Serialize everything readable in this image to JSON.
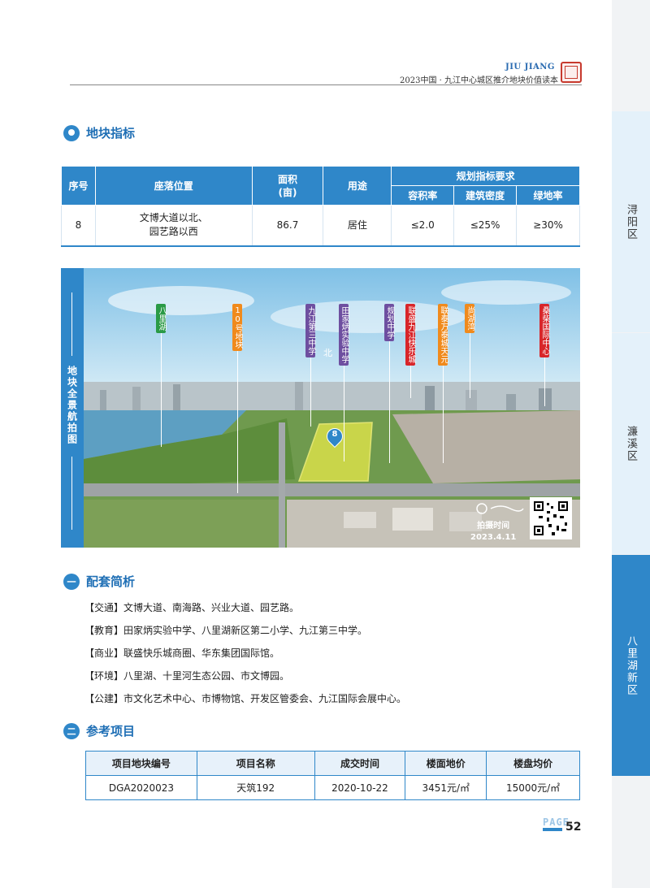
{
  "header": {
    "brand_en": "JIU JIANG",
    "book_title": "2023中国 · 九江中心城区推介地块价值读本"
  },
  "side_tabs": {
    "tab1": "浔阳区",
    "tab2": "濂溪区",
    "tab3": "八里湖新区"
  },
  "section_plot": {
    "title": "地块指标",
    "table": {
      "headers": {
        "no": "序号",
        "location": "座落位置",
        "area": "面积\n(亩)",
        "use": "用途",
        "planning": "规划指标要求",
        "far": "容积率",
        "density": "建筑密度",
        "green": "绿地率"
      },
      "row": {
        "no": "8",
        "location": "文博大道以北、\n园艺路以西",
        "area": "86.7",
        "use": "居住",
        "far": "≤2.0",
        "density": "≤25%",
        "green": "≥30%"
      }
    }
  },
  "photo": {
    "side_label": "地块全景航拍图",
    "north": "北",
    "marker": "8",
    "shoot_label": "拍摄时间",
    "shoot_date": "2023.4.11",
    "pois": [
      {
        "label": "八里湖",
        "color": "#2a9a46"
      },
      {
        "label": "10号地块",
        "color": "#f08a1c"
      },
      {
        "label": "九江第三中学",
        "color": "#6e4fa0"
      },
      {
        "label": "田家炳实验中学",
        "color": "#6e4fa0"
      },
      {
        "label": "规划中学",
        "color": "#6e4fa0"
      },
      {
        "label": "联盛九江快乐城",
        "color": "#d8262a"
      },
      {
        "label": "联泰万泰城天元",
        "color": "#f08a1c"
      },
      {
        "label": "尚湖湾",
        "color": "#f08a1c"
      },
      {
        "label": "桑柴国际中心",
        "color": "#d8262a"
      }
    ]
  },
  "section_support": {
    "num": "一",
    "title": "配套简析",
    "items": [
      "【交通】文博大道、南海路、兴业大道、园艺路。",
      "【教育】田家炳实验中学、八里湖新区第二小学、九江第三中学。",
      "【商业】联盛快乐城商圈、华东集团国际馆。",
      "【环境】八里湖、十里河生态公园、市文博园。",
      "【公建】市文化艺术中心、市博物馆、开发区管委会、九江国际会展中心。"
    ]
  },
  "section_ref": {
    "num": "二",
    "title": "参考项目",
    "headers": [
      "项目地块编号",
      "项目名称",
      "成交时间",
      "楼面地价",
      "楼盘均价"
    ],
    "rows": [
      [
        "DGA2020023",
        "天筑192",
        "2020-10-22",
        "3451元/㎡",
        "15000元/㎡"
      ]
    ]
  },
  "footer": {
    "page_word": "PAGE",
    "page_number": "52"
  }
}
